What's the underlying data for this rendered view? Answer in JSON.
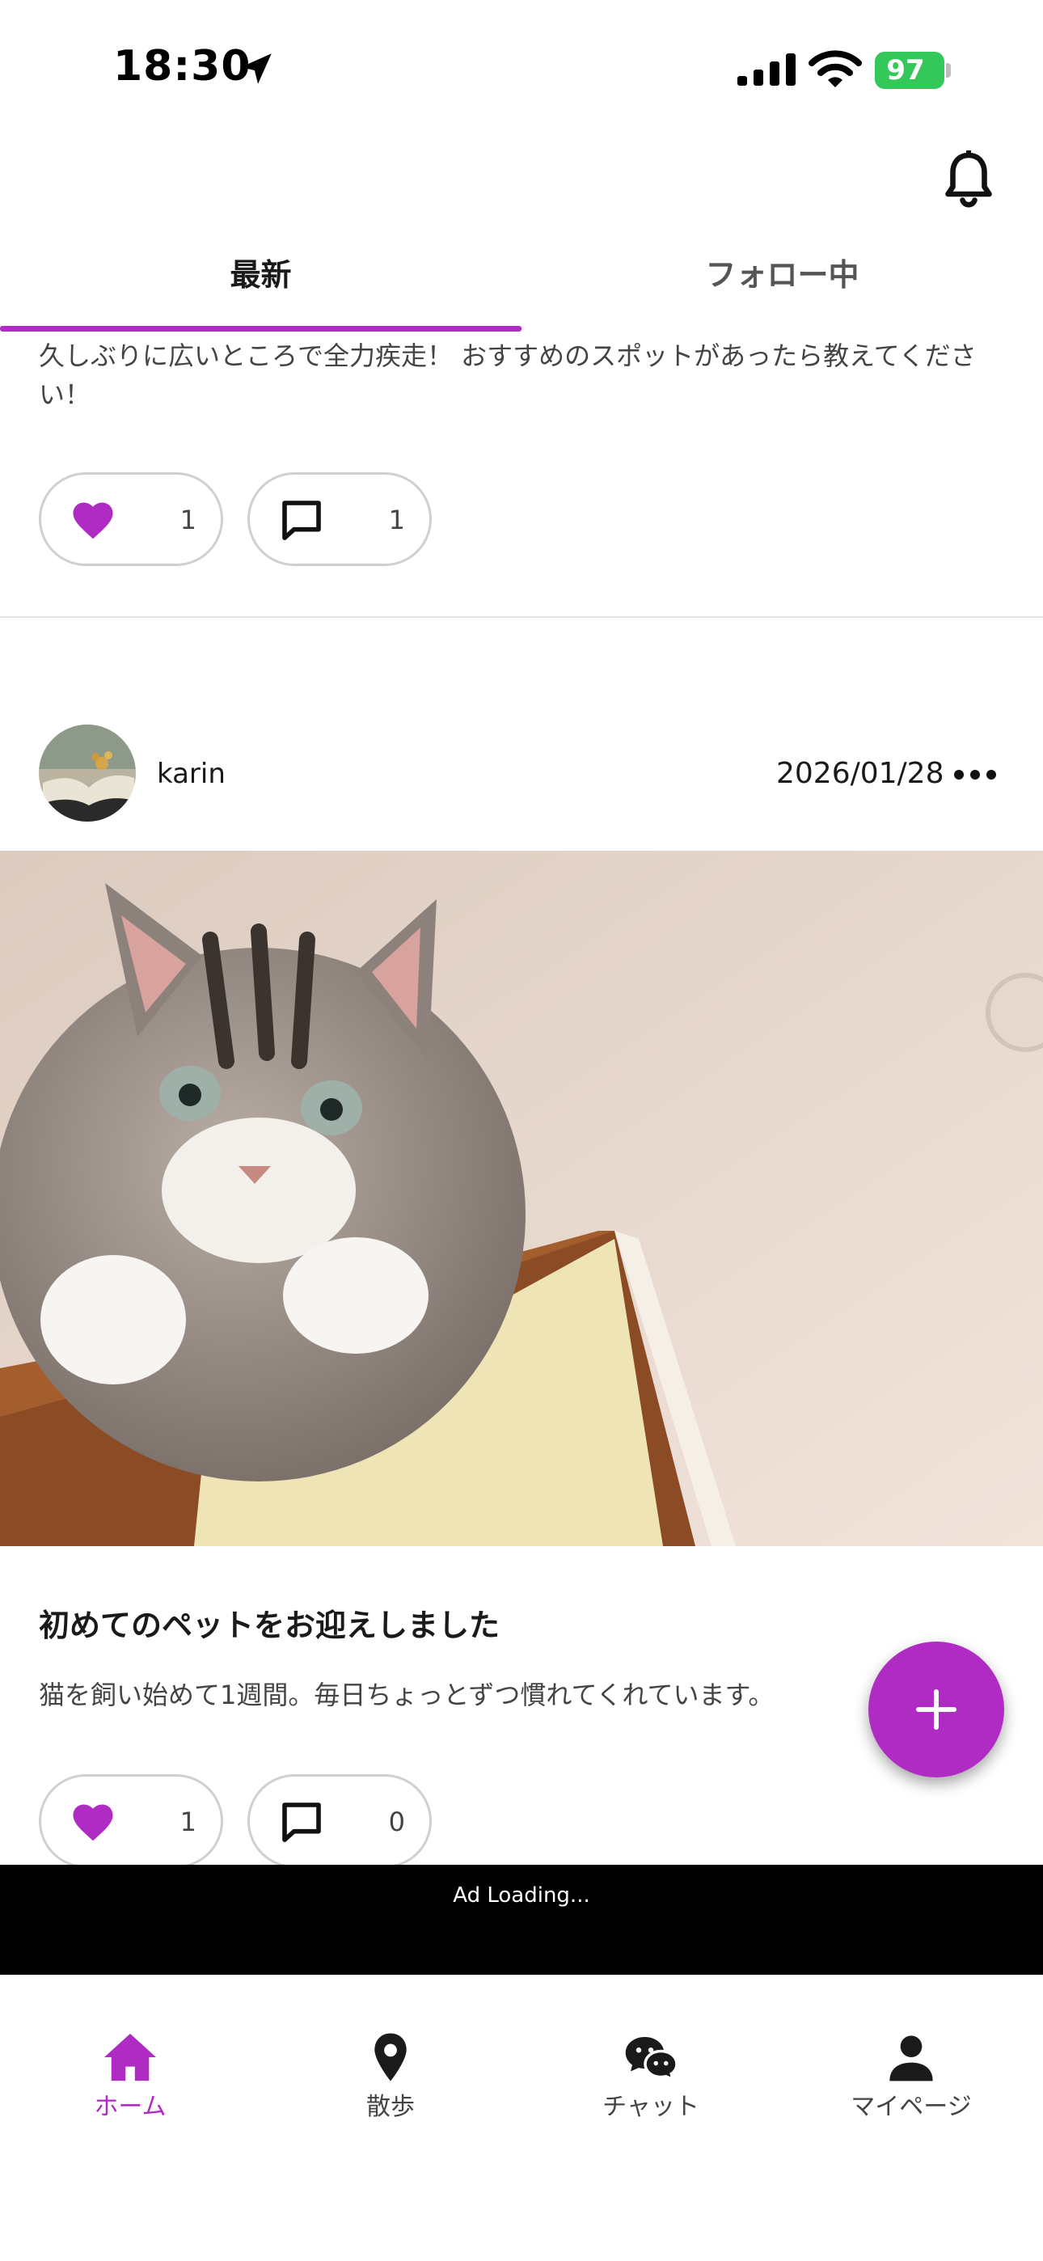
{
  "status_bar": {
    "time": "18:30",
    "battery": "97"
  },
  "tabs": [
    {
      "label": "最新"
    },
    {
      "label": "フォロー中"
    }
  ],
  "post1": {
    "text": "久しぶりに広いところで全力疾走！ おすすめのスポットがあったら教えてください！",
    "likes": "1",
    "comments": "1"
  },
  "post2": {
    "username": "karin",
    "date": "2026/01/28",
    "title": "初めてのペットをお迎えしました",
    "body": "猫を飼い始めて1週間。毎日ちょっとずつ慣れてくれています。",
    "likes": "1",
    "comments": "0"
  },
  "ad": {
    "text": "Ad Loading..."
  },
  "nav": [
    {
      "label": "ホーム"
    },
    {
      "label": "散歩"
    },
    {
      "label": "チャット"
    },
    {
      "label": "マイページ"
    }
  ],
  "colors": {
    "accent": "#b02bc4",
    "battery": "#34c759"
  }
}
